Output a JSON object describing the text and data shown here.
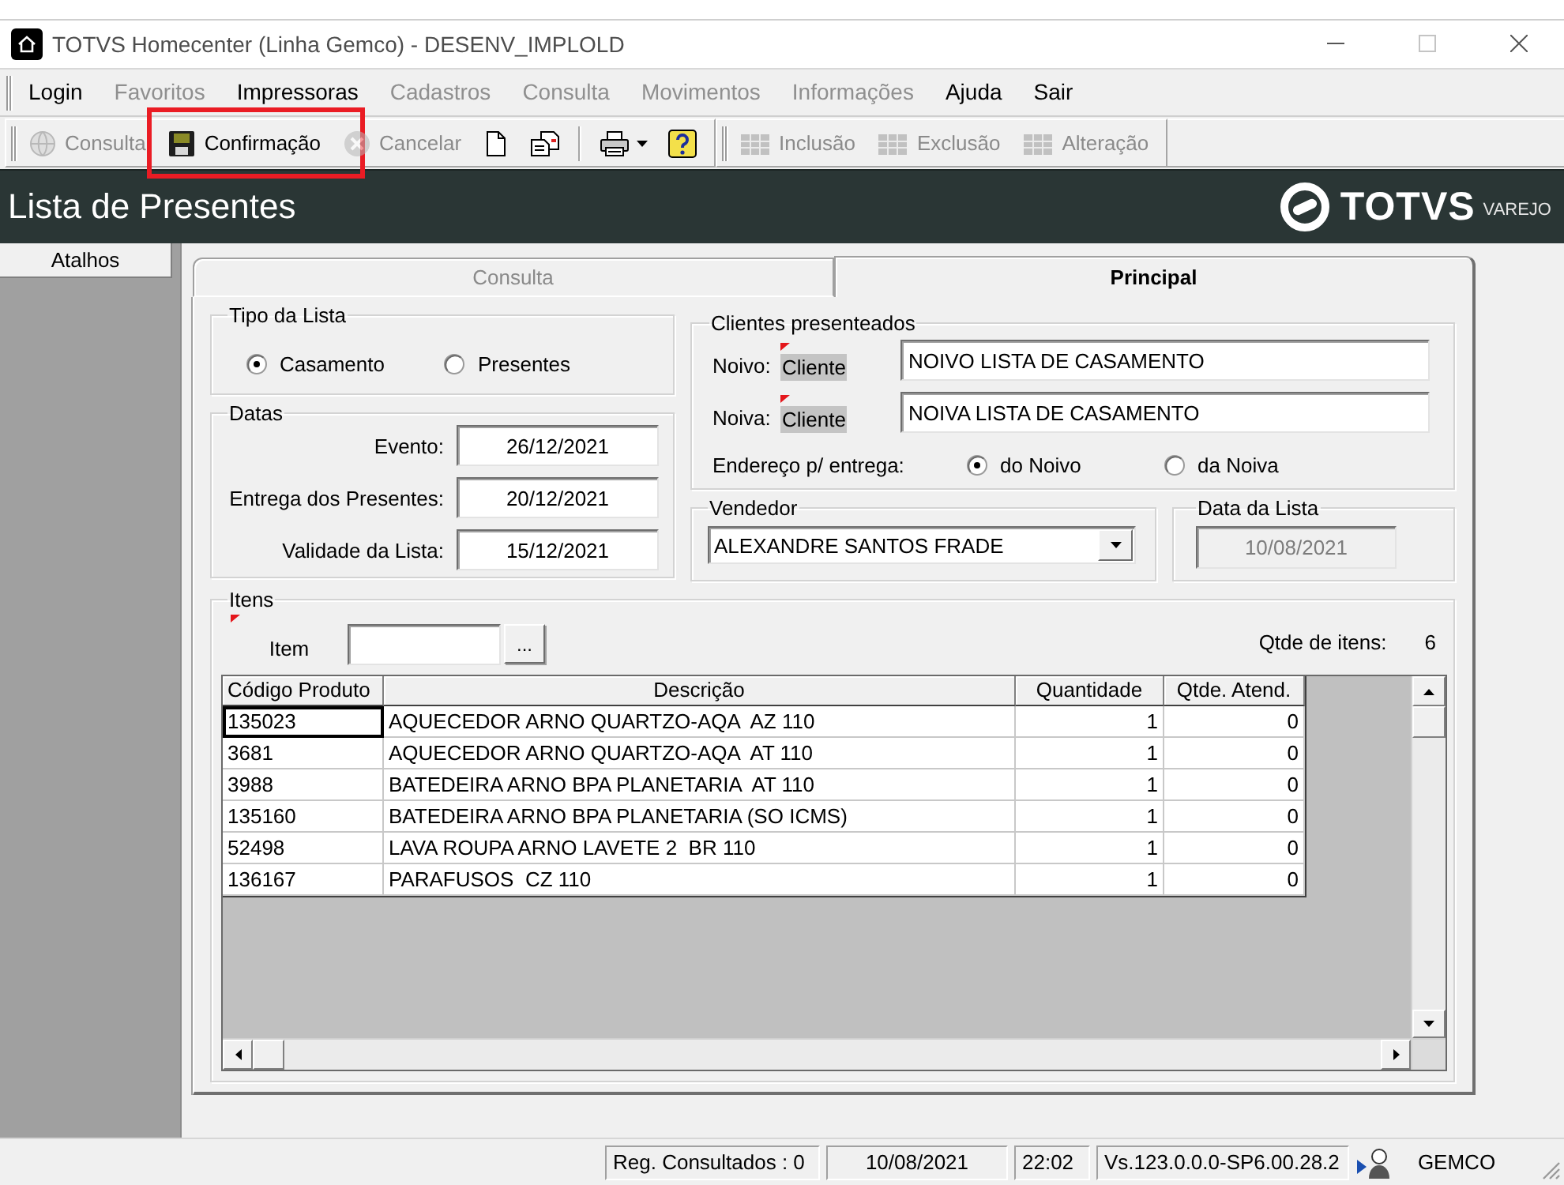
{
  "window": {
    "title": "TOTVS Homecenter (Linha Gemco) - DESENV_IMPLOLD"
  },
  "menu": [
    {
      "label": "Login",
      "disabled": false
    },
    {
      "label": "Favoritos",
      "disabled": true
    },
    {
      "label": "Impressoras",
      "disabled": false
    },
    {
      "label": "Cadastros",
      "disabled": true
    },
    {
      "label": "Consulta",
      "disabled": true
    },
    {
      "label": "Movimentos",
      "disabled": true
    },
    {
      "label": "Informações",
      "disabled": true
    },
    {
      "label": "Ajuda",
      "disabled": false
    },
    {
      "label": "Sair",
      "disabled": false
    }
  ],
  "toolbars": [
    {
      "items": [
        {
          "kind": "button",
          "label": "Consulta",
          "disabled": true,
          "highlighted": false
        },
        {
          "kind": "button",
          "label": "Confirmação",
          "disabled": false,
          "highlighted": true
        },
        {
          "kind": "button",
          "label": "Cancelar",
          "disabled": true,
          "highlighted": false
        },
        {
          "kind": "icon",
          "disabled": false
        },
        {
          "kind": "icon",
          "disabled": false
        },
        {
          "kind": "separator"
        },
        {
          "kind": "dropdown",
          "disabled": false
        },
        {
          "kind": "icon",
          "disabled": false
        }
      ]
    },
    {
      "items": [
        {
          "kind": "button",
          "label": "Inclusão",
          "disabled": true,
          "highlighted": false
        },
        {
          "kind": "button",
          "label": "Exclusão",
          "disabled": true,
          "highlighted": false
        },
        {
          "kind": "button",
          "label": "Alteração",
          "disabled": true,
          "highlighted": false
        }
      ]
    }
  ],
  "header": {
    "title": "Lista de Presentes",
    "logo": {
      "name": "TOTVS",
      "suffix": "VAREJO"
    }
  },
  "sidebar": {
    "title": "Atalhos"
  },
  "tabs": [
    {
      "label": "Consulta",
      "selected": false
    },
    {
      "label": "Principal",
      "selected": true
    }
  ],
  "tipo_lista": {
    "title": "Tipo da Lista",
    "options": [
      {
        "label": "Casamento",
        "selected": true
      },
      {
        "label": "Presentes",
        "selected": false
      }
    ]
  },
  "datas": {
    "title": "Datas",
    "fields": [
      {
        "label": "Evento:",
        "value": "26/12/2021"
      },
      {
        "label": "Entrega dos Presentes:",
        "value": "20/12/2021"
      },
      {
        "label": "Validade da Lista:",
        "value": "15/12/2021"
      }
    ]
  },
  "clientes": {
    "title": "Clientes presenteados",
    "rows": [
      {
        "label": "Noivo:",
        "tag": "Cliente",
        "required": true,
        "value": "NOIVO LISTA DE CASAMENTO"
      },
      {
        "label": "Noiva:",
        "tag": "Cliente",
        "required": true,
        "value": "NOIVA LISTA DE CASAMENTO"
      }
    ],
    "delivery": {
      "label": "Endereço p/ entrega:",
      "options": [
        {
          "label": "do Noivo",
          "selected": true
        },
        {
          "label": "da Noiva",
          "selected": false
        }
      ]
    }
  },
  "vendedor": {
    "title": "Vendedor",
    "value": "ALEXANDRE SANTOS FRADE"
  },
  "data_lista": {
    "title": "Data da Lista",
    "value": "10/08/2021",
    "disabled": true
  },
  "itens": {
    "title": "Itens",
    "item": {
      "label": "Item",
      "required": true,
      "button": "..."
    },
    "count_label": "Qtde de itens:",
    "count": "6",
    "columns": [
      "Código Produto",
      "Descrição",
      "Quantidade",
      "Qtde. Atend."
    ],
    "rows": [
      {
        "cells": [
          "135023",
          "AQUECEDOR ARNO QUARTZO-AQA  AZ 110",
          "1",
          "0"
        ],
        "focused": true
      },
      {
        "cells": [
          "3681",
          "AQUECEDOR ARNO QUARTZO-AQA  AT 110",
          "1",
          "0"
        ],
        "focused": false
      },
      {
        "cells": [
          "3988",
          "BATEDEIRA ARNO BPA PLANETARIA  AT 110",
          "1",
          "0"
        ],
        "focused": false
      },
      {
        "cells": [
          "135160",
          "BATEDEIRA ARNO BPA PLANETARIA (SO ICMS)",
          "1",
          "0"
        ],
        "focused": false
      },
      {
        "cells": [
          "52498",
          "LAVA ROUPA ARNO LAVETE 2  BR 110",
          "1",
          "0"
        ],
        "focused": false
      },
      {
        "cells": [
          "136167",
          "PARAFUSOS  CZ 110",
          "1",
          "0"
        ],
        "focused": false
      }
    ]
  },
  "status_bar": {
    "cells": [
      "Reg. Consultados : 0",
      "10/08/2021",
      "22:02",
      "Vs.123.0.0.0-SP6.00.28.2"
    ],
    "user": "GEMCO"
  }
}
